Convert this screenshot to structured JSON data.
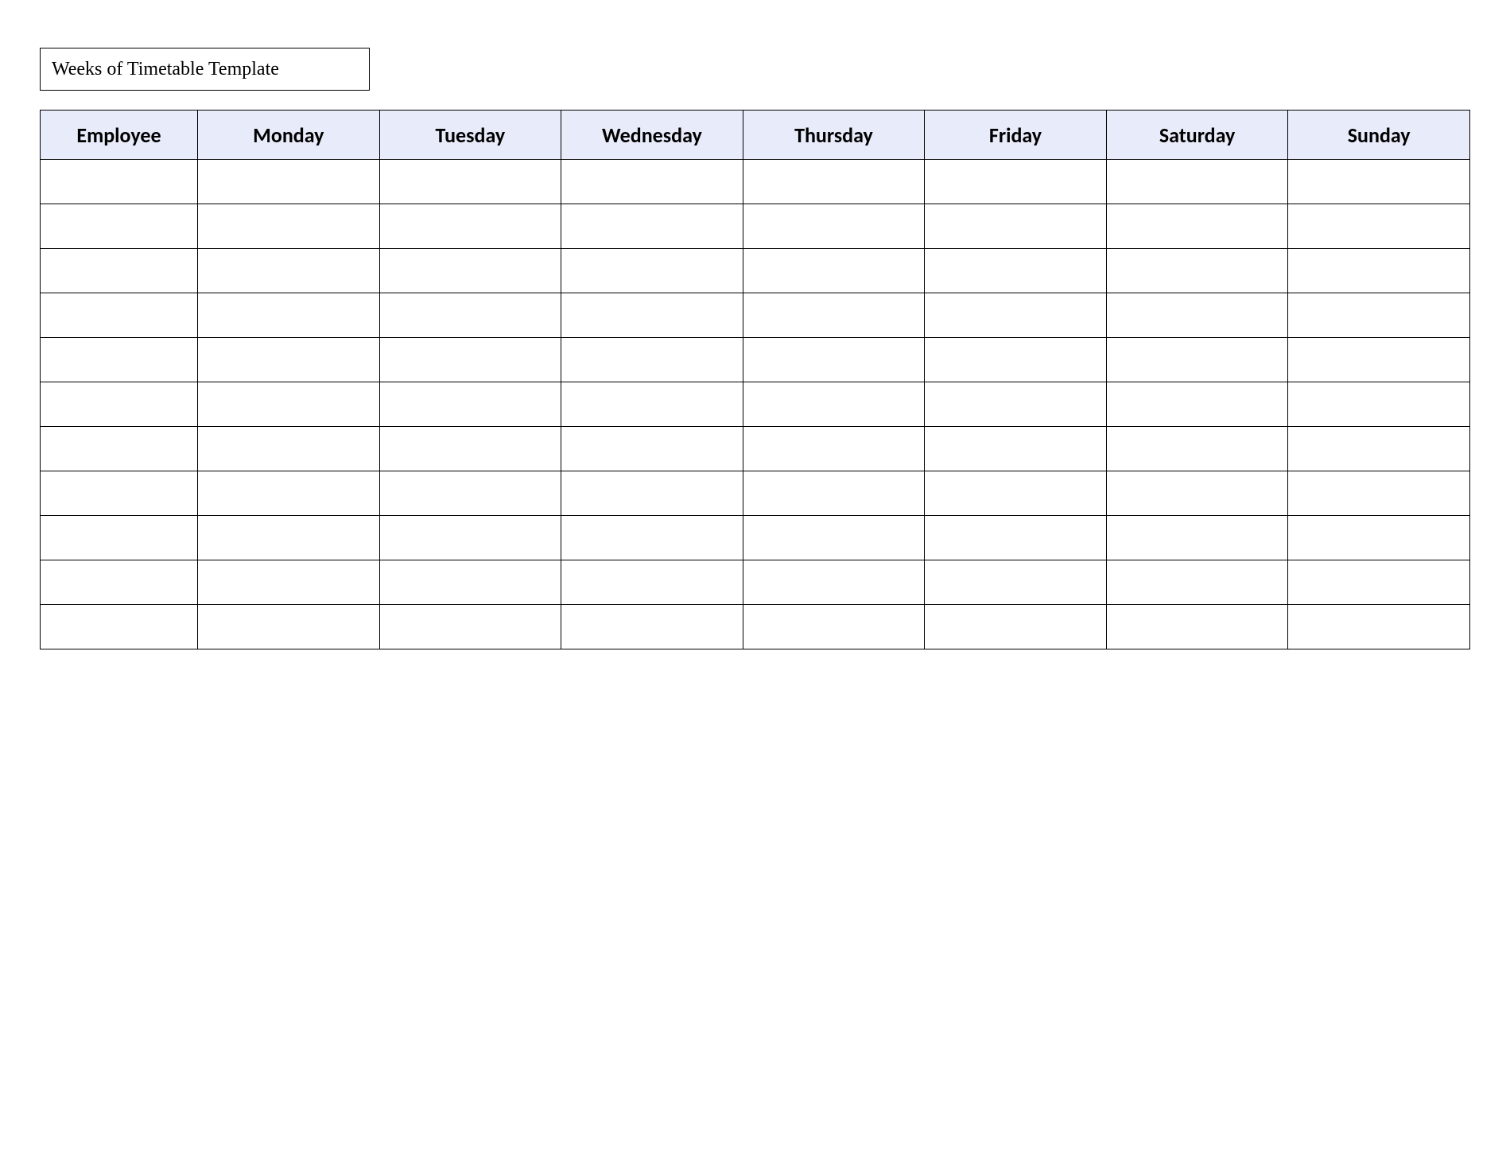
{
  "title": "Weeks of Timetable Template",
  "columns": [
    "Employee",
    "Monday",
    "Tuesday",
    "Wednesday",
    "Thursday",
    "Friday",
    "Saturday",
    "Sunday"
  ],
  "rows": [
    [
      "",
      "",
      "",
      "",
      "",
      "",
      "",
      ""
    ],
    [
      "",
      "",
      "",
      "",
      "",
      "",
      "",
      ""
    ],
    [
      "",
      "",
      "",
      "",
      "",
      "",
      "",
      ""
    ],
    [
      "",
      "",
      "",
      "",
      "",
      "",
      "",
      ""
    ],
    [
      "",
      "",
      "",
      "",
      "",
      "",
      "",
      ""
    ],
    [
      "",
      "",
      "",
      "",
      "",
      "",
      "",
      ""
    ],
    [
      "",
      "",
      "",
      "",
      "",
      "",
      "",
      ""
    ],
    [
      "",
      "",
      "",
      "",
      "",
      "",
      "",
      ""
    ],
    [
      "",
      "",
      "",
      "",
      "",
      "",
      "",
      ""
    ],
    [
      "",
      "",
      "",
      "",
      "",
      "",
      "",
      ""
    ],
    [
      "",
      "",
      "",
      "",
      "",
      "",
      "",
      ""
    ]
  ],
  "colors": {
    "header_bg": "#e8ecfa",
    "border": "#000000",
    "page_bg": "#ffffff"
  }
}
